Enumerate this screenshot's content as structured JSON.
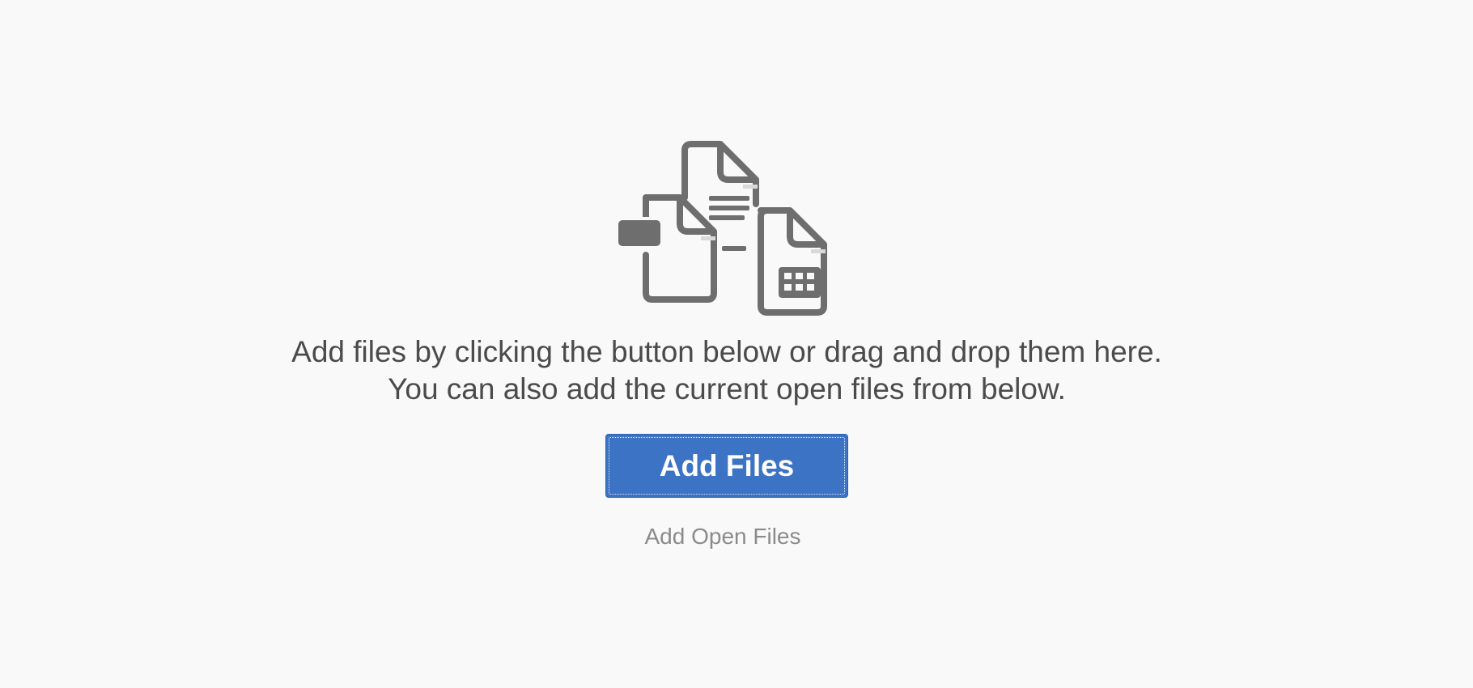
{
  "illustration": {
    "icon": "multiple-documents-icon",
    "color": "#6e6e6e"
  },
  "instructions": {
    "line1": "Add files by clicking the button below or drag and drop them here.",
    "line2": "You can also add the current open files from below."
  },
  "actions": {
    "add_files_label": "Add Files",
    "add_open_files_label": "Add Open Files"
  },
  "colors": {
    "background": "#f9f9f9",
    "primary_button": "#3c73c4",
    "text": "#4b4b4b",
    "link_text": "#8b8b8b"
  }
}
